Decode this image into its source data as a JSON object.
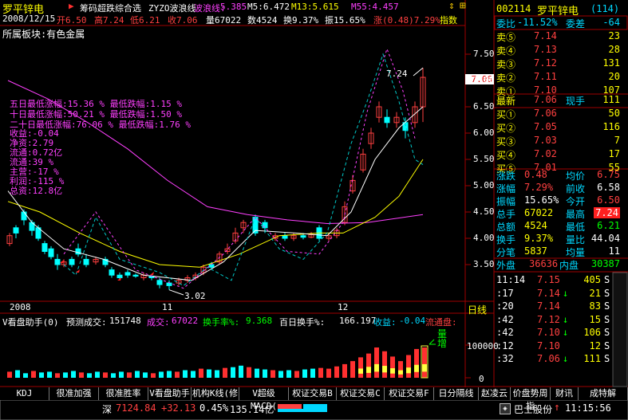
{
  "stock": {
    "name": "罗平锌电",
    "code": "002114",
    "full_name": "罗平锌电",
    "count": "(114)"
  },
  "header": {
    "indicator_name": "筹码超跌综合选",
    "zyzo": "ZYZO波浪线",
    "wave_label": "波浪线:",
    "wave_val": "5.385",
    "m5": "M5:6.472",
    "m13": "M13:5.615",
    "m55": "M55:4.457",
    "date": "2008/12/15",
    "open": "开6.50",
    "high": "高7.24",
    "low": "低6.21",
    "close": "收7.06",
    "vol": "量67022",
    "amount": "数4524",
    "turnover": "换9.37%",
    "amplitude": "振15.65%",
    "change": "涨(0.48)7.29%",
    "index_label": "指数"
  },
  "sector": "所属板块:有色金属",
  "annotations": {
    "l1": "五日最低涨幅:15.36 % 最低跌幅:1.15 %",
    "l2": "十日最低涨幅:50.21 % 最低跌幅:1.50 %",
    "l3": "二十日最低涨幅:76.06 % 最低跌幅:1.76 %",
    "l4": "收益:-0.04",
    "l5": "净资:2.79",
    "l6": "流通:0.72亿",
    "l7": "流通:39 %",
    "l8": "主营:-17 %",
    "l9": "利润:-115 %",
    "l10": "总资:12.8亿"
  },
  "price_labels": {
    "high_label": "7.24",
    "low_label": "3.02",
    "current": "7.06"
  },
  "y_ticks": [
    "7.50",
    "7.00",
    "6.50",
    "6.00",
    "5.50",
    "5.00",
    "4.50",
    "4.00",
    "3.50"
  ],
  "x_ticks": [
    "2008",
    "11",
    "12"
  ],
  "vol_panel": {
    "title": "V看盘助手(0)",
    "pred_label": "预测成交:",
    "pred_val": "151748",
    "deal_label": "成交:",
    "deal_val": "67022",
    "turn_label": "换手率%:",
    "turn_val": "9.368",
    "turn100_label": "百日换手%:",
    "turn100_val": "166.197",
    "income_label": "收益:",
    "income_val": "-0.04",
    "float_label": "流通盘:",
    "y_tick": "100000",
    "y_zero": "0",
    "vol_tag": "量",
    "inc_tag": "增"
  },
  "day_label": "日线",
  "tabs": [
    "KDJ",
    "很准加强",
    "很准胜率",
    "V看盘助手",
    "机构K线(修",
    "V超级MACD(",
    "权证交易B",
    "权证交易C",
    "权证交易F",
    "日分隔线",
    "赵凌云",
    "价盘势周指",
    "财讯",
    "成特解"
  ],
  "quote": {
    "webi": "委比",
    "webi_val": "-11.52%",
    "wecha": "委差",
    "wecha_val": "-64",
    "sells": [
      {
        "label": "卖⑤",
        "price": "7.14",
        "vol": "23"
      },
      {
        "label": "卖④",
        "price": "7.13",
        "vol": "28"
      },
      {
        "label": "卖③",
        "price": "7.12",
        "vol": "131"
      },
      {
        "label": "卖②",
        "price": "7.11",
        "vol": "20"
      },
      {
        "label": "卖①",
        "price": "7.10",
        "vol": "107"
      }
    ],
    "latest_label": "最新",
    "latest": "7.06",
    "now_label": "现手",
    "now_val": "111",
    "buys": [
      {
        "label": "买①",
        "price": "7.06",
        "vol": "50"
      },
      {
        "label": "买②",
        "price": "7.05",
        "vol": "116"
      },
      {
        "label": "买③",
        "price": "7.03",
        "vol": "7"
      },
      {
        "label": "买④",
        "price": "7.02",
        "vol": "17"
      },
      {
        "label": "买⑤",
        "price": "7.01",
        "vol": "55"
      }
    ],
    "stats": [
      {
        "l1": "涨跌",
        "v1": "0.48",
        "l2": "均价",
        "v2": "6.75"
      },
      {
        "l1": "涨幅",
        "v1": "7.29%",
        "l2": "前收",
        "v2": "6.58"
      },
      {
        "l1": "振幅",
        "v1": "15.65%",
        "l2": "今开",
        "v2": "6.50"
      },
      {
        "l1": "总手",
        "v1": "67022",
        "l2": "最高",
        "v2": "7.24"
      },
      {
        "l1": "总额",
        "v1": "4524",
        "l2": "最低",
        "v2": "6.21"
      },
      {
        "l1": "换手",
        "v1": "9.37%",
        "l2": "量比",
        "v2": "44.04"
      },
      {
        "l1": "分笔",
        "v1": "5837",
        "l2": "均量",
        "v2": "11"
      }
    ],
    "outer_label": "外盘",
    "outer_val": "36636",
    "inner_label": "内盘",
    "inner_val": "30387"
  },
  "ticks": [
    {
      "t": "11:14",
      "p": "7.15",
      "d": "",
      "v": "405",
      "s": "S"
    },
    {
      "t": ":17",
      "p": "7.14",
      "d": "↓",
      "v": "21",
      "s": "S"
    },
    {
      "t": ":20",
      "p": "7.14",
      "d": "",
      "v": "83",
      "s": "S"
    },
    {
      "t": ":42",
      "p": "7.12",
      "d": "↓",
      "v": "15",
      "s": "S"
    },
    {
      "t": ":42",
      "p": "7.10",
      "d": "↓",
      "v": "106",
      "s": "S"
    },
    {
      "t": ":12",
      "p": "7.10",
      "d": "",
      "v": "12",
      "s": "S"
    },
    {
      "t": ":32",
      "p": "7.06",
      "d": "↓",
      "v": "111",
      "s": "S"
    }
  ],
  "status": {
    "market": "深",
    "index": "7124.84",
    "chg": "+32.13",
    "pct": "0.45%",
    "amount": "135.14亿",
    "broker": "巴士股份",
    "arrow": "↑",
    "time": "11:15:56"
  }
}
